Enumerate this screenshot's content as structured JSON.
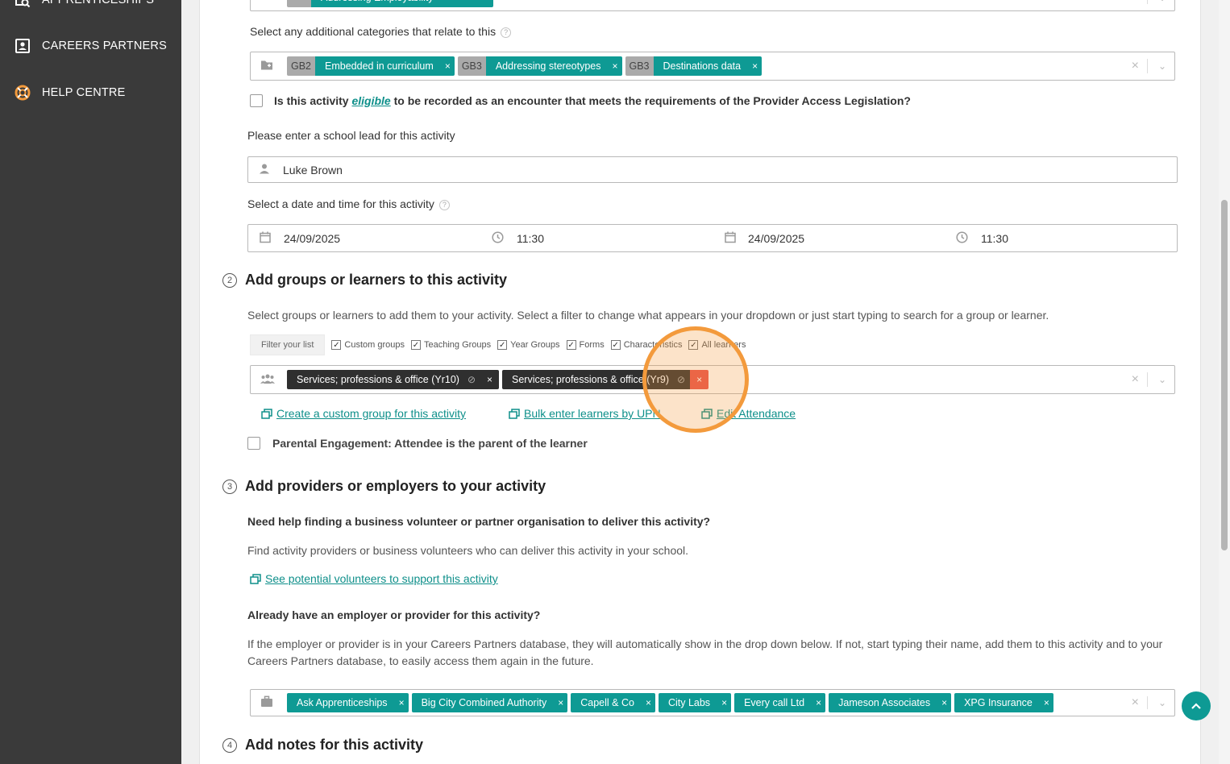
{
  "sidebar": {
    "items": [
      {
        "label": "APPRENTICESHIPS",
        "icon": "search-doc-icon"
      },
      {
        "label": "CAREERS PARTNERS",
        "icon": "contact-card-icon"
      },
      {
        "label": "HELP CENTRE",
        "icon": "lifebuoy-icon"
      }
    ]
  },
  "top_chip": {
    "code": "",
    "label": "Addressing Employability"
  },
  "additional_categories": {
    "label": "Select any additional categories that relate to this",
    "chips": [
      {
        "code": "GB2",
        "label": "Embedded in curriculum"
      },
      {
        "code": "GB3",
        "label": "Addressing stereotypes"
      },
      {
        "code": "GB3",
        "label": "Destinations data"
      }
    ]
  },
  "provider_access": {
    "prefix": "Is this activity",
    "link": "eligible",
    "suffix": "to be recorded as an encounter that meets the requirements of the Provider Access Legislation?"
  },
  "school_lead": {
    "label": "Please enter a school lead for this activity",
    "value": "Luke Brown"
  },
  "datetime": {
    "label": "Select a date and time for this activity",
    "start_date": "24/09/2025",
    "start_time": "11:30",
    "end_date": "24/09/2025",
    "end_time": "11:30"
  },
  "section2": {
    "number": "2",
    "title": "Add groups or learners to this activity",
    "description": "Select groups or learners to add them to your activity. Select a filter to change what appears in your dropdown or just start typing to search for a group or learner.",
    "filter_label": "Filter your list",
    "filters": [
      "Custom groups",
      "Teaching Groups",
      "Year Groups",
      "Forms",
      "Characteristics",
      "All learners"
    ],
    "chips": [
      "Services; professions & office (Yr10)",
      "Services; professions & office (Yr9)"
    ],
    "links": [
      "Create a custom group for this activity",
      "Bulk enter learners by UPN",
      "Edit Attendance"
    ],
    "parental": "Parental Engagement: Attendee is the parent of the learner"
  },
  "section3": {
    "number": "3",
    "title": "Add providers or employers to your activity",
    "help_heading": "Need help finding a business volunteer or partner organisation to deliver this activity?",
    "help_desc": "Find activity providers or business volunteers who can deliver this activity in your school.",
    "volunteers_link": "See potential volunteers to support this activity",
    "existing_heading": "Already have an employer or provider for this activity?",
    "existing_desc": "If the employer or provider is in your Careers Partners database, they will automatically show in the drop down below. If not, start typing their name, add them to this activity and to your Careers Partners database, to easily access them again in the future.",
    "providers": [
      "Ask Apprenticeships",
      "Big City Combined Authority",
      "Capell & Co",
      "City Labs",
      "Every call Ltd",
      "Jameson Associates",
      "XPG Insurance"
    ]
  },
  "section4": {
    "number": "4",
    "title": "Add notes for this activity"
  },
  "colors": {
    "accent": "#0e9a94",
    "sidebar": "#3a3a3a",
    "highlight": "#f39a3c"
  }
}
